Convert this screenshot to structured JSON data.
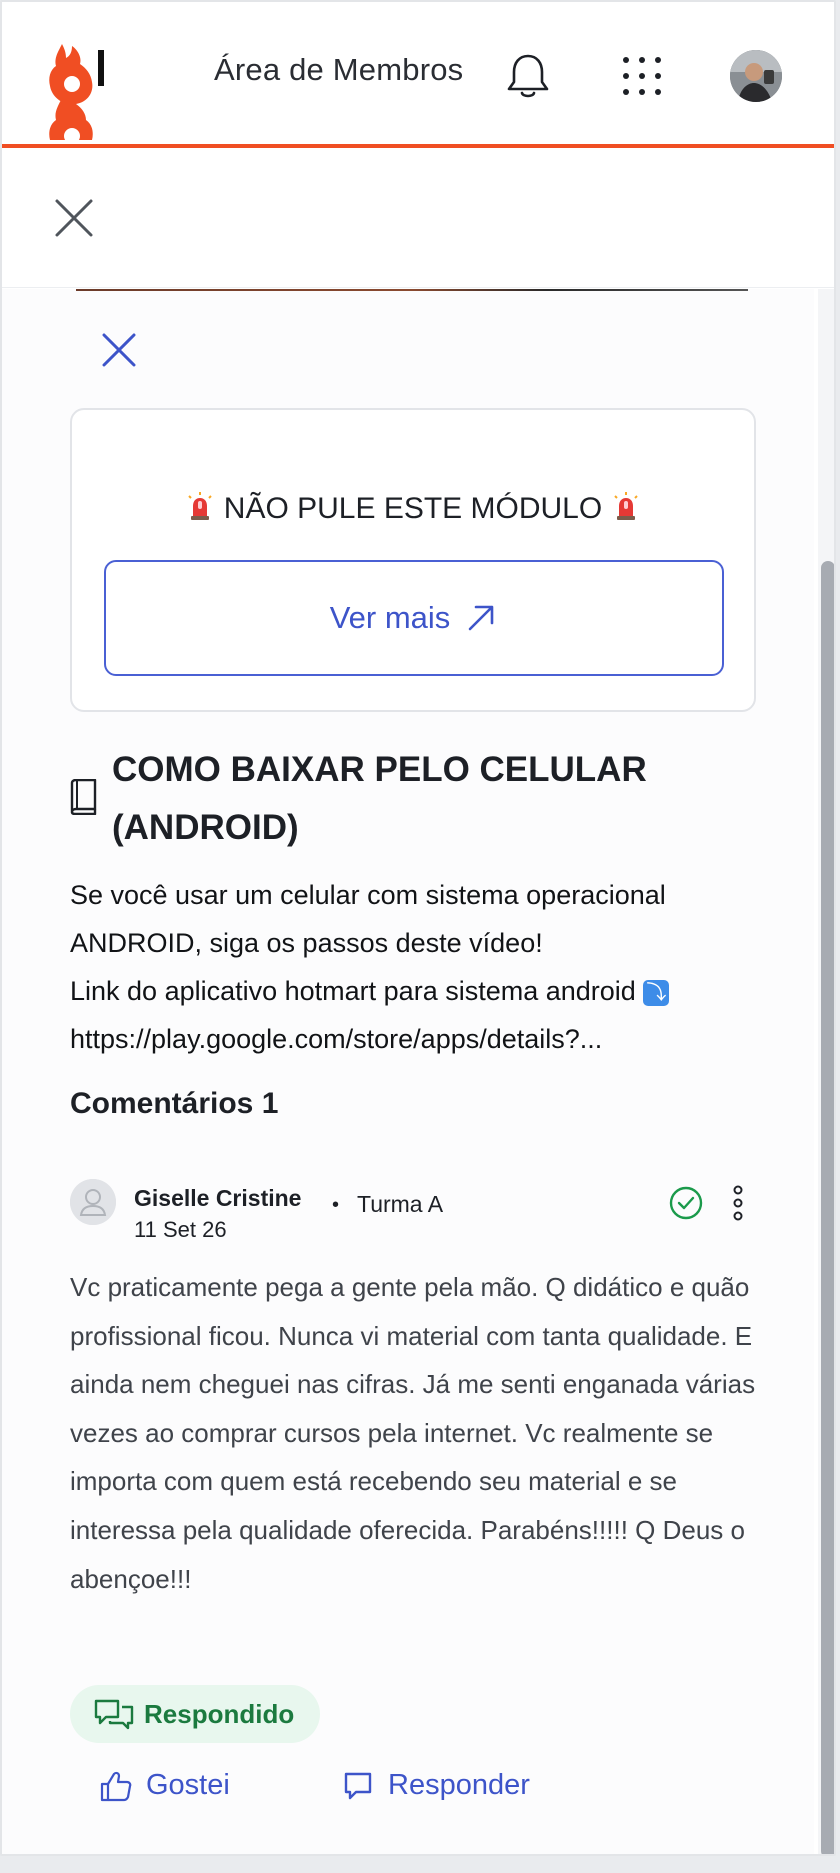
{
  "header": {
    "title": "Área de Membros",
    "notification_icon": "bell-icon",
    "apps_icon": "grid-icon",
    "brand_color": "#f04e23"
  },
  "lesson_banner": {
    "module_title": "NÃO PULE ESTE MÓDULO",
    "cta_label": "Ver mais"
  },
  "lesson": {
    "title": "COMO BAIXAR PELO CELULAR (ANDROID)",
    "description_lines": [
      "Se você usar um celular com sistema operacional",
      "ANDROID, siga os passos deste vídeo!",
      "Link do aplicativo hotmart para sistema android",
      "https://play.google.com/store/apps/details?..."
    ],
    "link_emoji": "⤵"
  },
  "comments": {
    "title": "Comentários 1",
    "items": [
      {
        "author": "Giselle Cristine",
        "date": "11 Set 26",
        "separator": "•",
        "class_name": "Turma A",
        "body": "Vc praticamente pega a gente pela mão. Q didático e quão profissional ficou. Nunca vi material com tanta qualidade. E ainda nem cheguei nas cifras. Já me senti enganada várias vezes ao comprar cursos pela internet. Vc realmente se importa com quem está recebendo seu material e se interessa pela qualidade oferecida. Parabéns!!!!! Q Deus o abençoe!!!",
        "status": "Respondido",
        "like_label": "Gostei",
        "reply_label": "Responder"
      }
    ]
  },
  "colors": {
    "accent": "#3d54c9",
    "answered_bg": "#e8f7ee",
    "answered_text": "#1b7a3f"
  }
}
